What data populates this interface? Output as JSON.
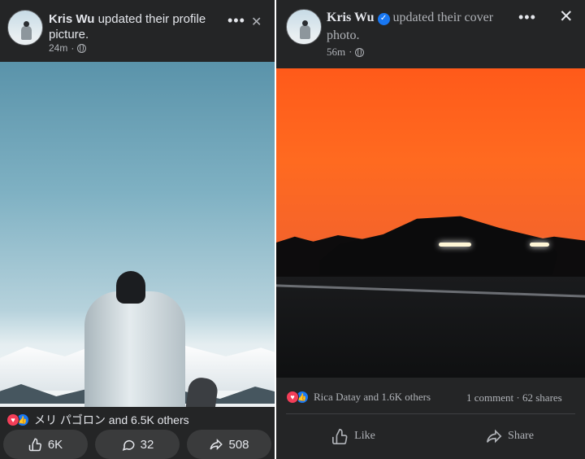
{
  "left_post": {
    "author": "Kris Wu",
    "action": "updated their profile picture.",
    "time": "24m",
    "reactions_text": "メリ パゴロン and 6.5K others",
    "buttons": {
      "like": "6K",
      "comment": "32",
      "share": "508"
    }
  },
  "right_post": {
    "author": "Kris Wu",
    "action": "updated their cover photo.",
    "time": "56m",
    "reactions_text": "Rica Datay and 1.6K others",
    "comments": "1 comment",
    "shares": "62 shares",
    "buttons": {
      "like": "Like",
      "share": "Share"
    }
  },
  "icons": {
    "more": "•••",
    "close": "✕"
  },
  "colors": {
    "background": "#242526",
    "like_blue": "#1877f2",
    "love_red": "#f33e58",
    "text_primary": "#e4e6eb",
    "text_secondary": "#b0b3b8"
  }
}
